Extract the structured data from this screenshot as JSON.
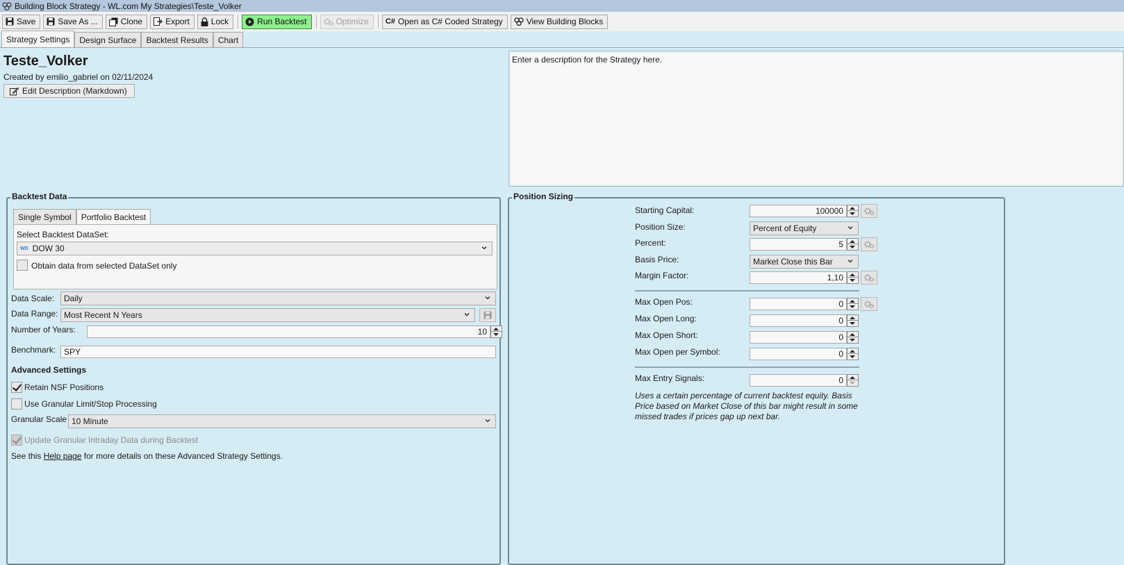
{
  "window": {
    "title": "Building Block Strategy - WL.com My Strategies\\Teste_Volker"
  },
  "toolbar": {
    "save": "Save",
    "save_as": "Save As ...",
    "clone": "Clone",
    "export": "Export",
    "lock": "Lock",
    "run_backtest": "Run Backtest",
    "optimize": "Optimize",
    "open_csharp": "Open as C# Coded Strategy",
    "view_blocks": "View Building Blocks",
    "run_color": "#8df08d"
  },
  "tabs": [
    "Strategy Settings",
    "Design Surface",
    "Backtest Results",
    "Chart"
  ],
  "strategy": {
    "name": "Teste_Volker",
    "created_by": "Created by emilio_gabriel on 02/11/2024",
    "edit_description": "Edit Description (Markdown)",
    "description_placeholder": "Enter a description for the Strategy here."
  },
  "backtest_data": {
    "title": "Backtest Data",
    "subtabs": [
      "Single Symbol",
      "Portfolio Backtest"
    ],
    "select_dataset_label": "Select Backtest DataSet:",
    "dataset_badge": "WD",
    "dataset_value": "DOW 30",
    "obtain_only_label": "Obtain data from selected DataSet only",
    "data_scale_label": "Data Scale:",
    "data_scale_value": "Daily",
    "data_range_label": "Data Range:",
    "data_range_value": "Most Recent N Years",
    "num_years_label": "Number of Years:",
    "num_years_value": "10",
    "benchmark_label": "Benchmark:",
    "benchmark_value": "SPY",
    "advanced_title": "Advanced Settings",
    "retain_nsf_label": "Retain NSF Positions",
    "granular_limit_label": "Use Granular Limit/Stop Processing",
    "granular_scale_label": "Granular Scale",
    "granular_scale_value": "10 Minute",
    "update_granular_label": "Update Granular Intraday Data during Backtest",
    "help_prefix": "See this ",
    "help_link": "Help page",
    "help_suffix": " for more details on these Advanced Strategy Settings."
  },
  "position_sizing": {
    "title": "Position Sizing",
    "starting_capital_label": "Starting Capital:",
    "starting_capital_value": "100000",
    "position_size_label": "Position Size:",
    "position_size_value": "Percent of Equity",
    "percent_label": "Percent:",
    "percent_value": "5",
    "basis_price_label": "Basis Price:",
    "basis_price_value": "Market Close this Bar",
    "margin_factor_label": "Margin Factor:",
    "margin_factor_value": "1,10",
    "max_open_pos_label": "Max Open Pos:",
    "max_open_pos_value": "0",
    "max_open_long_label": "Max Open Long:",
    "max_open_long_value": "0",
    "max_open_short_label": "Max Open Short:",
    "max_open_short_value": "0",
    "max_open_symbol_label": "Max Open per Symbol:",
    "max_open_symbol_value": "0",
    "max_entry_signals_label": "Max Entry Signals:",
    "max_entry_signals_value": "0",
    "note_line1": "Uses a certain percentage of current backtest equity. Basis",
    "note_line2": "Price based on Market Close of this bar might result in some",
    "note_line3": "missed trades if prices gap up next bar."
  }
}
